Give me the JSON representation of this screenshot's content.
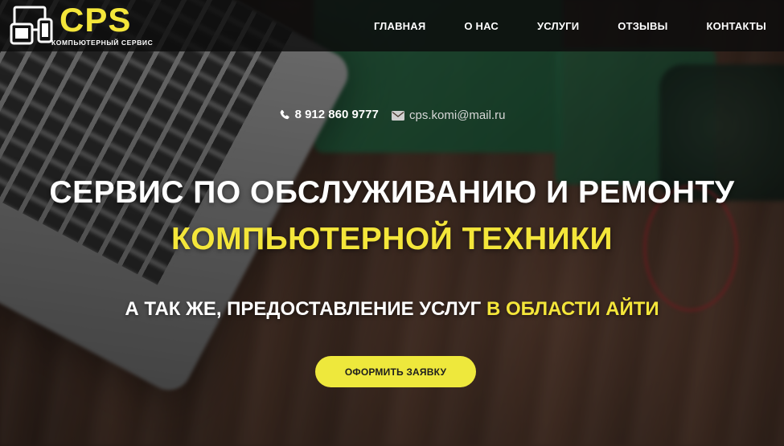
{
  "brand": {
    "name": "CPS",
    "tagline": "КОМПЬЮТЕРНЫЙ СЕРВИС",
    "accent_color": "#f4e63a",
    "logo_icon": "devices-icon"
  },
  "nav": {
    "items": [
      {
        "label": "ГЛАВНАЯ"
      },
      {
        "label": "О НАС"
      },
      {
        "label": "УСЛУГИ"
      },
      {
        "label": "ОТЗЫВЫ"
      },
      {
        "label": "КОНТАКТЫ"
      }
    ]
  },
  "contacts": {
    "phone": {
      "icon": "phone-icon",
      "text": "8 912 860 9777"
    },
    "email": {
      "icon": "envelope-icon",
      "text": "cps.komi@mail.ru"
    }
  },
  "hero": {
    "line1": "СЕРВИС ПО ОБСЛУЖИВАНИЮ И РЕМОНТУ",
    "line2": "КОМПЬЮТЕРНОЙ ТЕХНИКИ",
    "subline_white": "А ТАК ЖЕ, ПРЕДОСТАВЛЕНИЕ УСЛУГ",
    "subline_accent": "В ОБЛАСТИ АЙТИ",
    "cta_label": "ОФОРМИТЬ ЗАЯВКУ",
    "cta_color": "#eee83c"
  }
}
